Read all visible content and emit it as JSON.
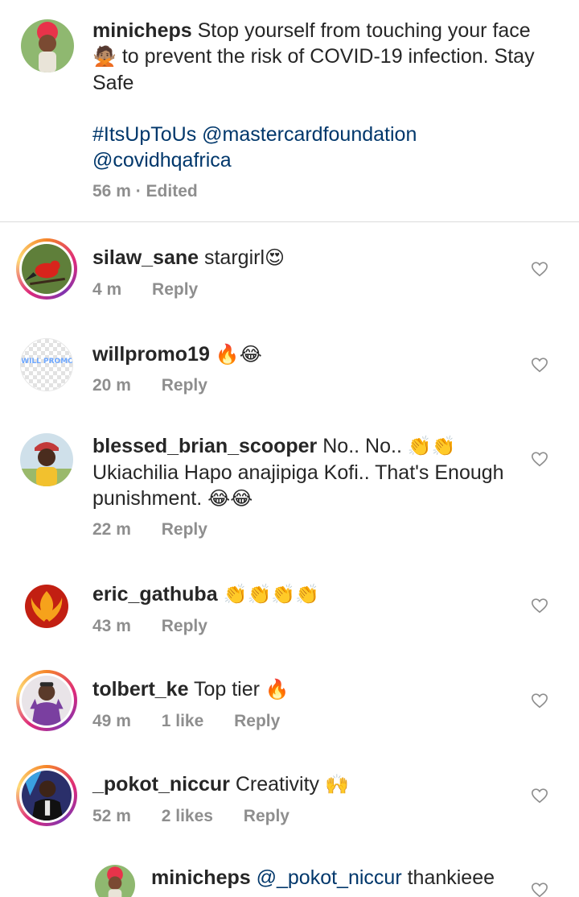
{
  "caption": {
    "username": "minicheps",
    "text_part1": "Stop yourself from touching your face",
    "emoji1": "🙅🏽",
    "text_part2": "to prevent the risk of COVID-19 infection. Stay Safe",
    "hashtag": "#ItsUpToUs",
    "mention1": "@mastercardfoundation",
    "mention2": "@covidhqafrica",
    "time": "56 m",
    "edited": "· Edited"
  },
  "comments": [
    {
      "username": "silaw_sane",
      "text": "stargirl",
      "emoji": "😍",
      "time": "4 m",
      "likes": "",
      "reply": "Reply"
    },
    {
      "username": "willpromo19",
      "text": "",
      "emoji": "🔥😂",
      "time": "20 m",
      "likes": "",
      "reply": "Reply"
    },
    {
      "username": "blessed_brian_scooper",
      "text": "No.. No..",
      "emoji": "👏👏",
      "text2": "Ukiachilia Hapo anajipiga Kofi.. That's Enough punishment.",
      "emoji2": "😂😂",
      "time": "22 m",
      "likes": "",
      "reply": "Reply"
    },
    {
      "username": "eric_gathuba",
      "text": "",
      "emoji": "👏👏👏👏",
      "time": "43 m",
      "likes": "",
      "reply": "Reply"
    },
    {
      "username": "tolbert_ke",
      "text": "Top tier",
      "emoji": "🔥",
      "time": "49 m",
      "likes": "1 like",
      "reply": "Reply"
    },
    {
      "username": "_pokot_niccur",
      "text": "Creativity",
      "emoji": "🙌",
      "time": "52 m",
      "likes": "2 likes",
      "reply": "Reply"
    }
  ],
  "reply": {
    "username": "minicheps",
    "mention": "@_pokot_niccur",
    "text": "thankieee"
  },
  "avatar_overlay_text": "WILL PROMO",
  "colors": {
    "text": "#262626",
    "muted": "#8e8e8e",
    "link": "#00376b",
    "divider": "#dbdbdb"
  }
}
